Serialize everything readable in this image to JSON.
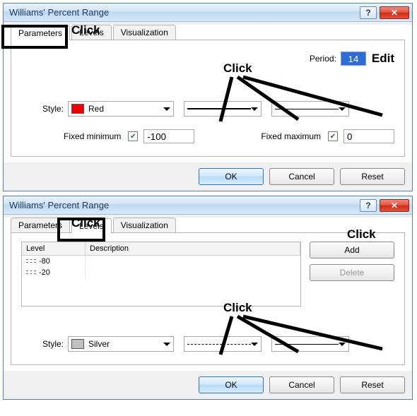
{
  "dialog1": {
    "title": "Williams' Percent Range",
    "tabs": {
      "parameters": "Parameters",
      "levels": "Levels",
      "visualization": "Visualization"
    },
    "period_label": "Period:",
    "period_value": "14",
    "style_label": "Style:",
    "style_color_name": "Red",
    "fixed_min_label": "Fixed minimum",
    "fixed_min_value": "-100",
    "fixed_max_label": "Fixed maximum",
    "fixed_max_value": "0",
    "buttons": {
      "ok": "OK",
      "cancel": "Cancel",
      "reset": "Reset"
    },
    "annot": {
      "click_tab": "Click",
      "click_style": "Click",
      "edit_period": "Edit"
    }
  },
  "dialog2": {
    "title": "Williams' Percent Range",
    "tabs": {
      "parameters": "Parameters",
      "levels": "Levels",
      "visualization": "Visualization"
    },
    "table": {
      "head_level": "Level",
      "head_desc": "Description",
      "rows": [
        {
          "level": "-80",
          "desc": ""
        },
        {
          "level": "-20",
          "desc": ""
        }
      ]
    },
    "side": {
      "add": "Add",
      "delete": "Delete"
    },
    "style_label": "Style:",
    "style_color_name": "Silver",
    "buttons": {
      "ok": "OK",
      "cancel": "Cancel",
      "reset": "Reset"
    },
    "annot": {
      "click_tab": "Click",
      "click_add": "Click",
      "click_style": "Click"
    }
  }
}
